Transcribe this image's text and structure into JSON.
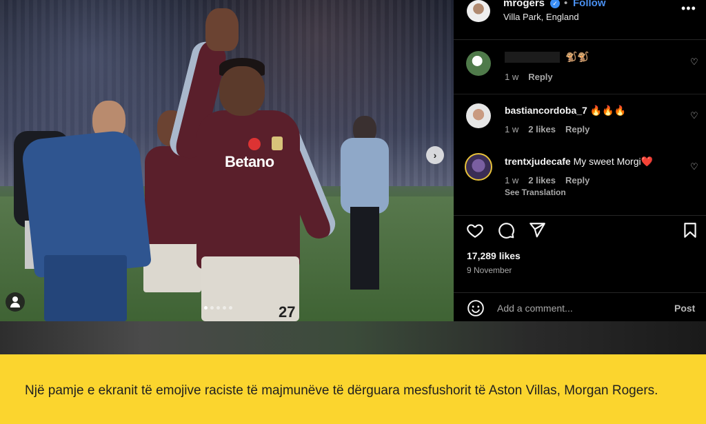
{
  "post": {
    "username": "mrogers",
    "verified_mark": "✓",
    "separator": "•",
    "follow_label": "Follow",
    "location": "Villa Park, England",
    "more_label": "•••",
    "photo": {
      "sponsor_text": "Betano",
      "shirt_number": "27",
      "carousel_next": "›",
      "carousel_dots": 5,
      "active_dot": 0
    },
    "comments": [
      {
        "username": "",
        "text": "🐒🐒",
        "time": "1 w",
        "likes": "",
        "reply_label": "Reply",
        "heart": "♡"
      },
      {
        "username": "bastiancordoba_7",
        "text": "🔥🔥🔥",
        "time": "1 w",
        "likes": "2 likes",
        "reply_label": "Reply",
        "heart": "♡"
      },
      {
        "username": "trentxjudecafe",
        "text": "My sweet Morgi❤️",
        "time": "1 w",
        "likes": "2 likes",
        "reply_label": "Reply",
        "heart": "♡",
        "see_translation": "See Translation"
      }
    ],
    "likes_count": "17,289 likes",
    "date": "9 November",
    "add_comment_placeholder": "Add a comment...",
    "post_label": "Post"
  },
  "caption": "Një pamje e ekranit të emojive raciste të majmunëve të dërguara mesfushorit të Aston Villas, Morgan Rogers.",
  "colors": {
    "caption_bg": "#fbd52e",
    "follow_blue": "#4a90f0",
    "jersey": "#5a1f2b"
  },
  "icons": [
    "user-tag-icon",
    "chevron-right-icon",
    "verified-icon",
    "more-options-icon",
    "heart-icon",
    "comment-icon",
    "share-icon",
    "bookmark-icon",
    "emoji-icon"
  ]
}
